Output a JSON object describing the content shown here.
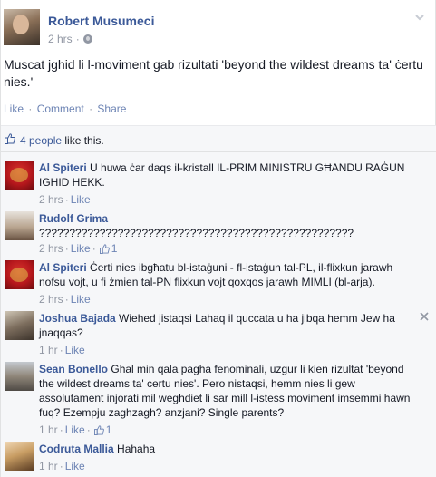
{
  "post": {
    "author": "Robert Musumeci",
    "time": "2 hrs",
    "meta_separator": "·",
    "text": "Muscat jghid li l-moviment gab rizultati 'beyond the wildest dreams ta' ċertu nies.'",
    "actions": {
      "like": "Like",
      "comment": "Comment",
      "share": "Share",
      "separator": "·"
    }
  },
  "likes": {
    "people": "4 people",
    "suffix": " like this."
  },
  "comments": [
    {
      "name": "Al Spiteri",
      "text": "U huwa ċar daqs il-kristall IL-PRIM MINISTRU GĦANDU RAĠUN IGĦID HEKK.",
      "time": "2 hrs",
      "like": "Like",
      "likes_count": ""
    },
    {
      "name": "Rudolf Grima",
      "text": "????????????????????????????????????????????????????",
      "time": "2 hrs",
      "like": "Like",
      "likes_count": "1"
    },
    {
      "name": "Al Spiteri",
      "text": "Ċerti nies ibgħatu bl-istaġuni - fl-istaġun tal-PL, il-flixkun jarawh nofsu vojt, u fi żmien tal-PN flixkun vojt qoxqos jarawh MIMLI (bl-arja).",
      "time": "2 hrs",
      "like": "Like",
      "likes_count": ""
    },
    {
      "name": "Joshua Bajada",
      "text": "Wiehed jistaqsi Lahaq il quccata u ha jibqa hemm Jew ha jnaqqas?",
      "time": "1 hr",
      "like": "Like",
      "likes_count": ""
    },
    {
      "name": "Sean Bonello",
      "text": "Ghal min qala pagha fenominali, uzgur li kien rizultat 'beyond the wildest dreams ta' certu nies'. Pero nistaqsi, hemm nies li gew assolutament injorati mil weghdiet li sar mill l-istess moviment imsemmi hawn fuq? Ezempju zaghzagh? anzjani? Single parents?",
      "time": "1 hr",
      "like": "Like",
      "likes_count": "1"
    },
    {
      "name": "Codruta Mallia",
      "text": "Hahaha",
      "time": "1 hr",
      "like": "Like",
      "likes_count": ""
    }
  ],
  "meta_separator": "·",
  "icons": {
    "globe": "globe-icon",
    "chevron": "chevron-down-icon",
    "like": "thumbs-up-icon",
    "close": "close-icon"
  },
  "colors": {
    "link_blue": "#3b5998",
    "muted_link": "#6d84b4",
    "meta_gray": "#9197a3",
    "comments_bg": "#f6f7f9"
  }
}
